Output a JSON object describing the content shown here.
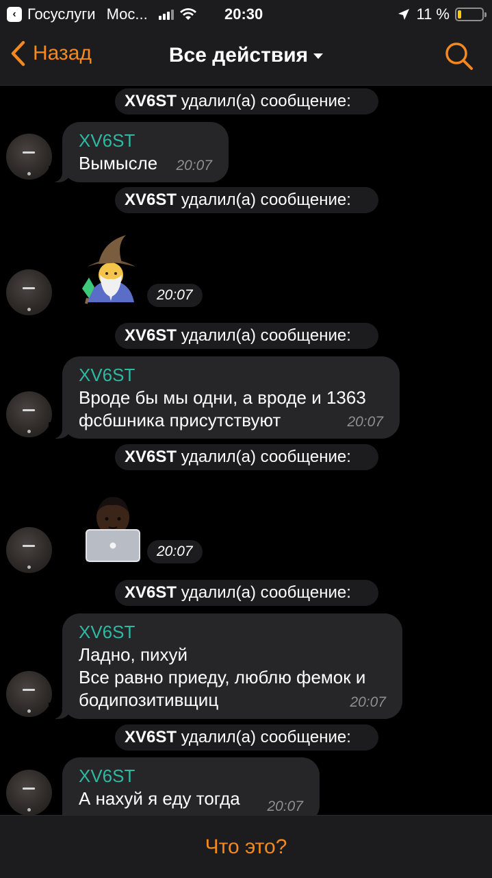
{
  "status_bar": {
    "app_back": "Госуслуги",
    "carrier": "Мос...",
    "time": "20:30",
    "battery": "11 %",
    "battery_fraction": 0.11
  },
  "nav": {
    "back_label": "Назад",
    "title": "Все действия",
    "accent": "#f5891f"
  },
  "events": [
    {
      "user": "XV6ST",
      "action": "удалил(а) сообщение:"
    },
    {
      "user": "XV6ST",
      "action": "удалил(а) сообщение:"
    },
    {
      "user": "XV6ST",
      "action": "удалил(а) сообщение:"
    },
    {
      "user": "XV6ST",
      "action": "удалил(а) сообщение:"
    },
    {
      "user": "XV6ST",
      "action": "удалил(а) сообщение:"
    },
    {
      "user": "XV6ST",
      "action": "удалил(а) сообщение:"
    }
  ],
  "messages": [
    {
      "sender": "XV6ST",
      "text": "Вымысле",
      "time": "20:07"
    },
    {
      "sticker": "wizard-emoji",
      "time": "20:07"
    },
    {
      "sender": "XV6ST",
      "lines": [
        "Вроде бы мы одни, а вроде и 1363",
        "фсбшника присутствуют"
      ],
      "time": "20:07"
    },
    {
      "sticker": "technologist-emoji",
      "time": "20:07"
    },
    {
      "sender": "XV6ST",
      "lines": [
        "Ладно, пихуй",
        "Все равно приеду, люблю фемок и",
        "бодипозитивщиц"
      ],
      "time": "20:07"
    },
    {
      "sender": "XV6ST",
      "text": "А нахуй я еду тогда",
      "time": "20:07"
    }
  ],
  "bottom": {
    "action_label": "Что это?"
  },
  "colors": {
    "sender": "#2fb8a2",
    "bubble": "#262628",
    "bar": "#1c1c1e"
  }
}
